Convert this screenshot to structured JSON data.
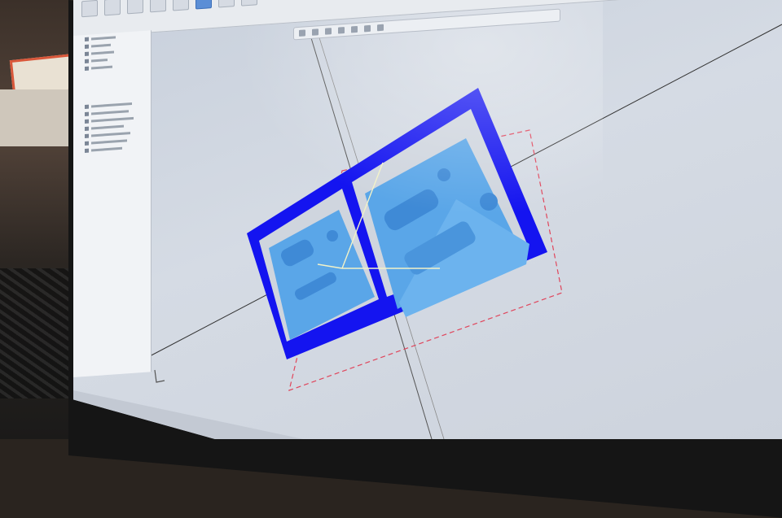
{
  "app": {
    "ribbon_tab": "",
    "active_tool_index": 5
  },
  "browser_tree": {
    "items": [
      "",
      "",
      "",
      "",
      "",
      "",
      "",
      "",
      "",
      "",
      "",
      ""
    ]
  },
  "scene": {
    "frame_color": "#1414f0",
    "part_color": "#5aa6e8",
    "part_detail_color": "#3f8ad6",
    "stock_outline_color": "#e0455b",
    "axis_color": "#333333",
    "background_color": "#cfd5de",
    "origin_triad_color": "#f2f2c8"
  },
  "icons": [
    "component-icon",
    "sketch-icon",
    "body-icon",
    "origin-icon"
  ]
}
